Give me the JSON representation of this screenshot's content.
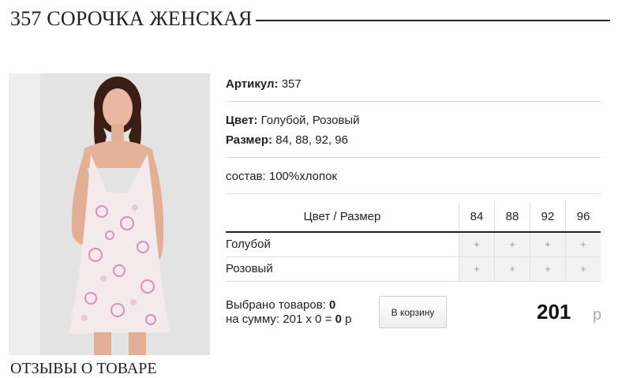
{
  "page": {
    "title": "357 СОРОЧКА ЖЕНСКАЯ",
    "reviews_heading": "ОТЗЫВЫ О ТОВАРЕ"
  },
  "product": {
    "article_label": "Артикул:",
    "article_value": "357",
    "color_label": "Цвет:",
    "color_value": "Голубой, Розовый",
    "size_label": "Размер:",
    "size_value": "84, 88, 92, 96",
    "composition": "состав: 100%хлопок"
  },
  "grid": {
    "header_label": "Цвет / Размер",
    "sizes": [
      "84",
      "88",
      "92",
      "96"
    ],
    "rows": [
      {
        "color": "Голубой",
        "cells": [
          "+",
          "+",
          "+",
          "+"
        ]
      },
      {
        "color": "Розовый",
        "cells": [
          "+",
          "+",
          "+",
          "+"
        ]
      }
    ]
  },
  "summary": {
    "selected_label": "Выбрано товаров:",
    "selected_count": "0",
    "sum_label": "на сумму: 201 x 0 =",
    "sum_value": "0",
    "sum_currency": "р"
  },
  "cart_button": "В корзину",
  "price": {
    "value": "201",
    "currency": "р"
  },
  "colors": {
    "text": "#222222",
    "cell_bg": "#f2f2f2",
    "separator": "#dedede"
  }
}
